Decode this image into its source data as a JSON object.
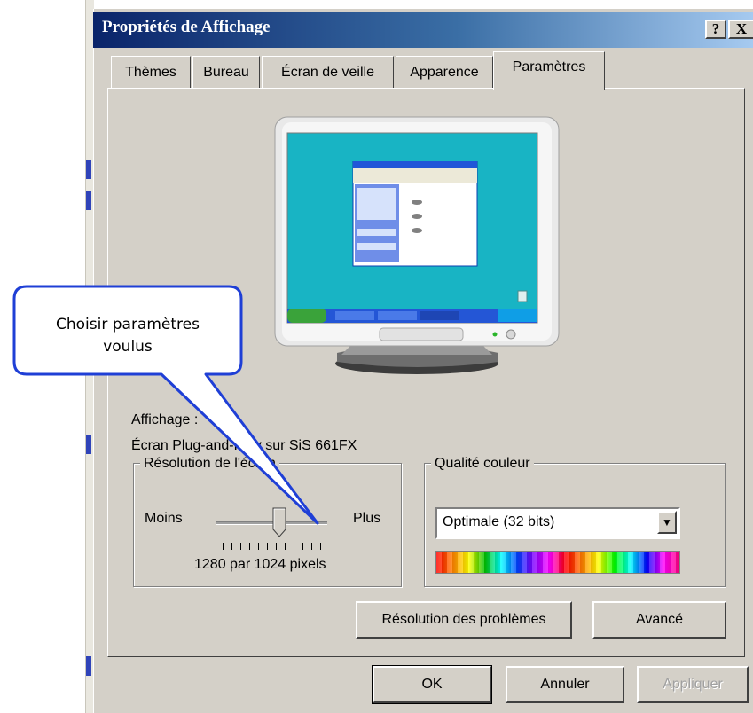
{
  "window": {
    "title": "Propriétés de Affichage"
  },
  "title_buttons": {
    "help": "?",
    "close": "X"
  },
  "tabs": [
    {
      "label": "Thèmes",
      "active": false
    },
    {
      "label": "Bureau",
      "active": false
    },
    {
      "label": "Écran de veille",
      "active": false
    },
    {
      "label": "Apparence",
      "active": false
    },
    {
      "label": "Paramètres",
      "active": true
    }
  ],
  "display": {
    "heading": "Affichage :",
    "device": "Écran Plug-and-Play sur SiS 661FX"
  },
  "resolution": {
    "group_label": "Résolution de l'écran",
    "less_label": "Moins",
    "more_label": "Plus",
    "value_text": "1280 par 1024 pixels",
    "slider_position": 0.6
  },
  "color_quality": {
    "group_label": "Qualité couleur",
    "selected": "Optimale (32 bits)"
  },
  "buttons": {
    "troubleshoot": "Résolution des problèmes",
    "advanced": "Avancé",
    "ok": "OK",
    "cancel": "Annuler",
    "apply": "Appliquer"
  },
  "callout": {
    "line1": "Choisir paramètres",
    "line2": "voulus"
  },
  "colors": {
    "title_start": "#0a246a",
    "title_end": "#a6caf0",
    "dialog_face": "#d4d0c8",
    "desktop_teal": "#18b4c4",
    "callout_border": "#1f3fd6"
  },
  "icons": [
    "help-icon",
    "close-icon",
    "monitor-preview",
    "dropdown-arrow-icon",
    "color-spectrum"
  ]
}
